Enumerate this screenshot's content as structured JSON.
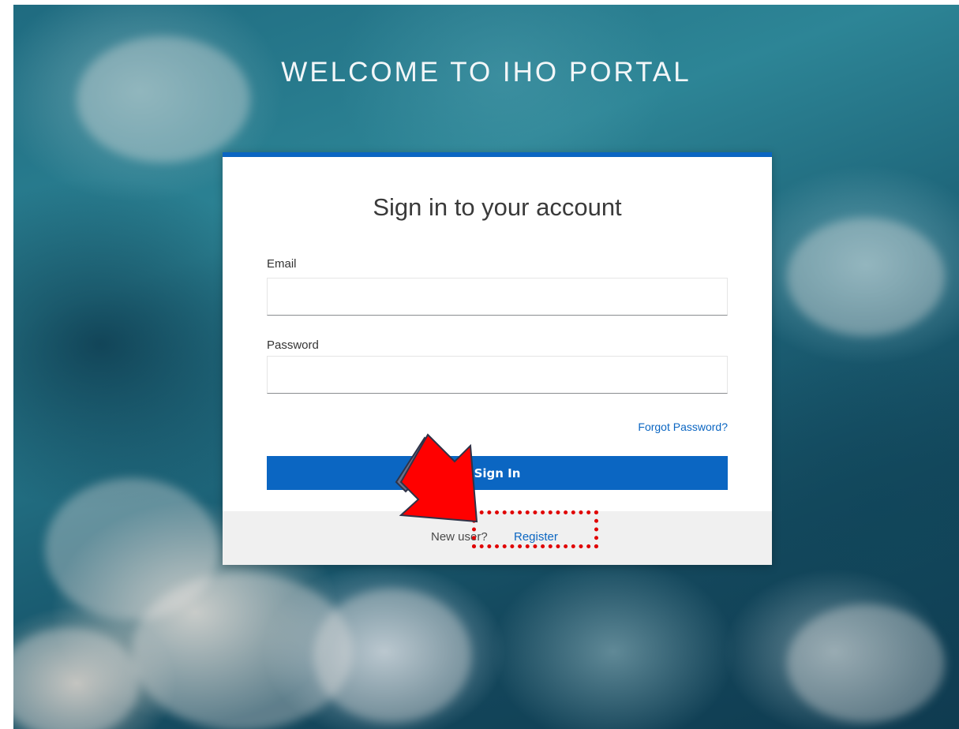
{
  "page": {
    "welcome_title": "WELCOME TO IHO PORTAL"
  },
  "login_card": {
    "title": "Sign in to your account",
    "email": {
      "label": "Email",
      "value": ""
    },
    "password": {
      "label": "Password",
      "value": ""
    },
    "forgot_password_label": "Forgot Password?",
    "sign_in_label": "Sign In",
    "footer": {
      "new_user_text": "New user?",
      "register_label": "Register"
    }
  },
  "annotations": {
    "arrow_color": "#ff0000",
    "highlight_color": "#e00000",
    "arrow_icon": "red-pointer-arrow-icon"
  },
  "colors": {
    "accent": "#0b66c2",
    "footer_bg": "#f0f0f0"
  }
}
